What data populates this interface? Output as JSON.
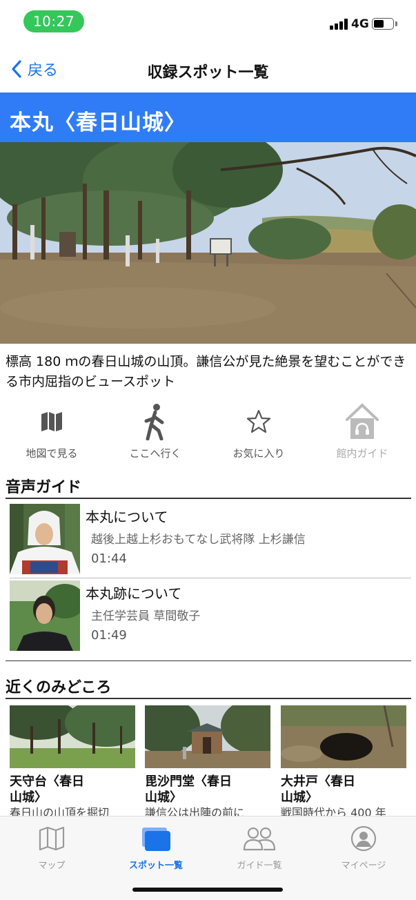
{
  "status_bar": {
    "time": "10:27",
    "network": "4G",
    "battery_level": 0.55
  },
  "nav": {
    "back_label": "戻る",
    "title": "収録スポット一覧"
  },
  "spot": {
    "name": "本丸〈春日山城〉",
    "description": "標高 180 ｍの春日山城の山頂。謙信公が見た絶景を望むことができる市内屈指のビュースポット"
  },
  "actions": [
    {
      "label": "地図で見る",
      "icon": "map-icon",
      "enabled": true
    },
    {
      "label": "ここへ行く",
      "icon": "walking-icon",
      "enabled": true
    },
    {
      "label": "お気に入り",
      "icon": "star-icon",
      "enabled": true
    },
    {
      "label": "館内ガイド",
      "icon": "building-guide-icon",
      "enabled": false
    }
  ],
  "audio_guide": {
    "title": "音声ガイド",
    "items": [
      {
        "title": "本丸について",
        "speaker": "越後上越上杉おもてなし武将隊 上杉謙信",
        "duration": "01:44"
      },
      {
        "title": "本丸跡について",
        "speaker": "主任学芸員 草間敬子",
        "duration": "01:49"
      }
    ]
  },
  "nearby": {
    "title": "近くのみどころ",
    "items": [
      {
        "name_line1": "天守台〈春日",
        "name_line2": "山城〉",
        "desc": "春日山の山頂を掘切"
      },
      {
        "name_line1": "毘沙門堂〈春日",
        "name_line2": "山城〉",
        "desc": "謙信公は出陣の前に"
      },
      {
        "name_line1": "大井戸〈春日",
        "name_line2": "山城〉",
        "desc": "戦国時代から 400 年"
      }
    ]
  },
  "tabs": [
    {
      "label": "マップ",
      "icon": "map-icon",
      "active": false
    },
    {
      "label": "スポット一覧",
      "icon": "cards-icon",
      "active": true
    },
    {
      "label": "ガイド一覧",
      "icon": "people-icon",
      "active": false
    },
    {
      "label": "マイページ",
      "icon": "user-icon",
      "active": false
    }
  ],
  "colors": {
    "accent": "#2f7cf6",
    "link": "#1a73e8",
    "status_green": "#34c759"
  }
}
